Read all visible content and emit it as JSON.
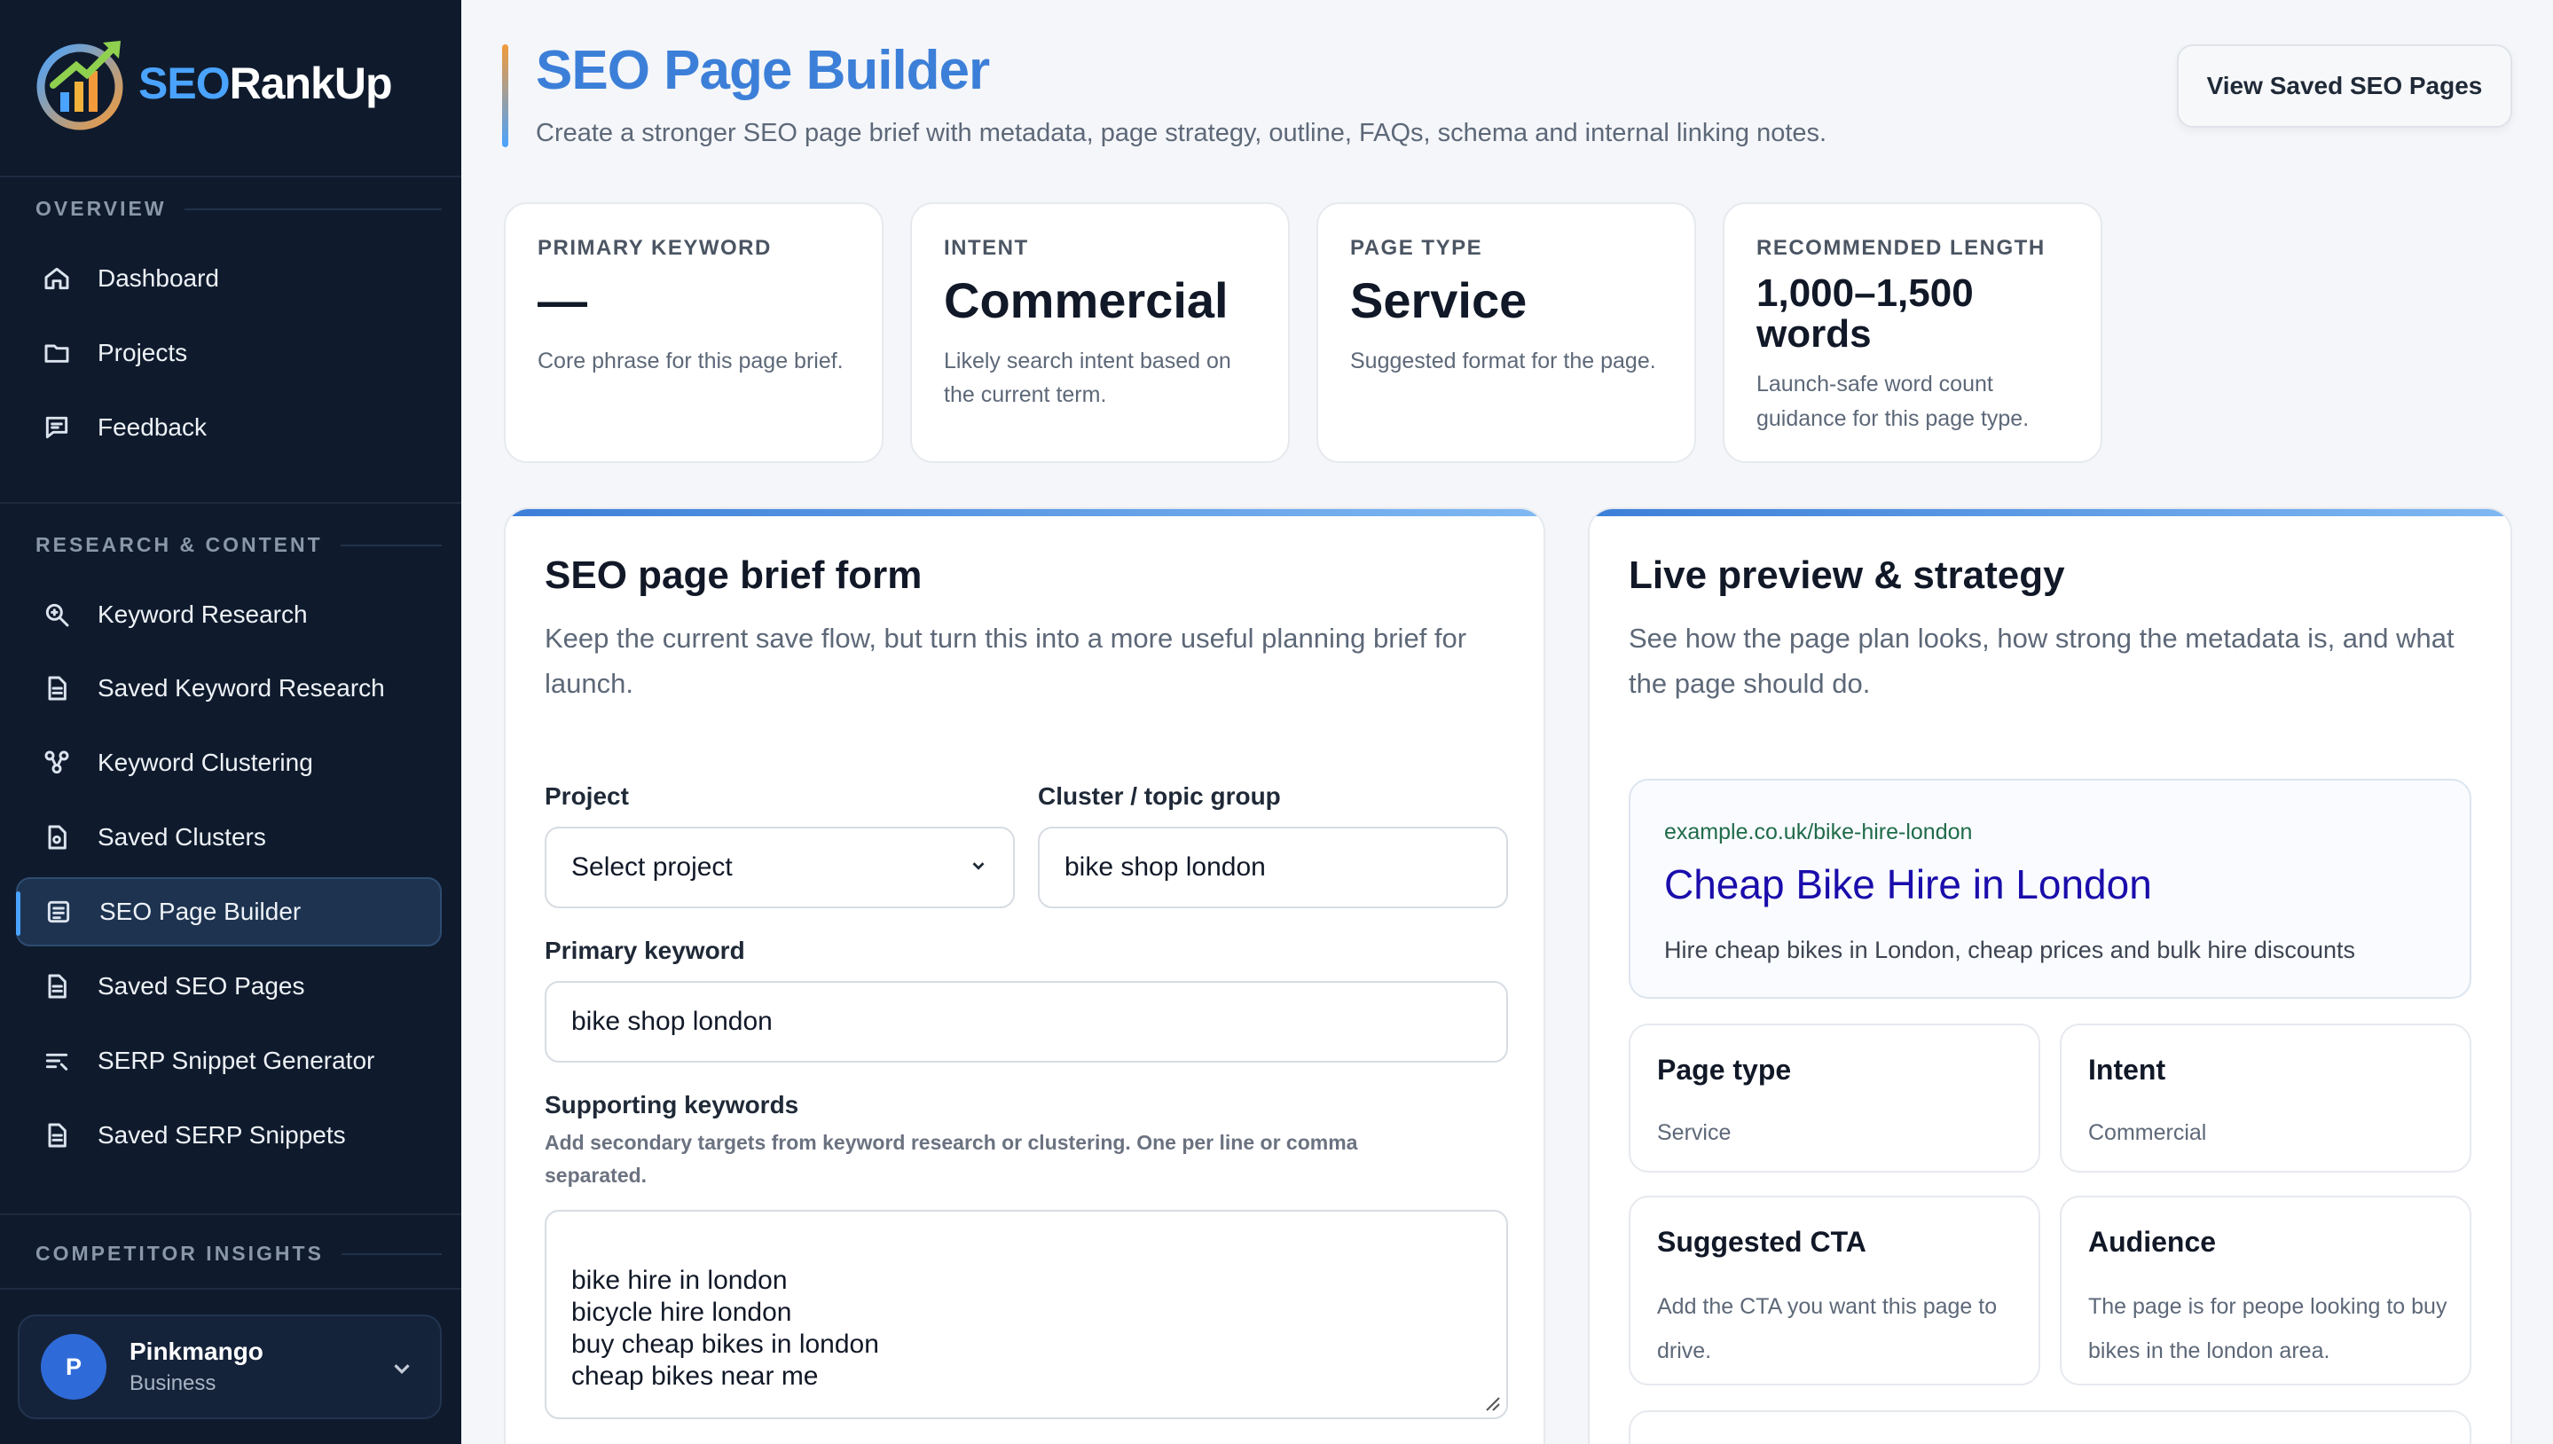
{
  "brand": {
    "seo": "SEO",
    "rank": "RankUp"
  },
  "sidebar": {
    "sections": {
      "overview": "OVERVIEW",
      "research": "RESEARCH & CONTENT",
      "competitor": "COMPETITOR INSIGHTS"
    },
    "overview_items": [
      {
        "label": "Dashboard",
        "icon": "home-icon"
      },
      {
        "label": "Projects",
        "icon": "folder-icon"
      },
      {
        "label": "Feedback",
        "icon": "message-icon"
      }
    ],
    "research_items": [
      {
        "label": "Keyword Research",
        "icon": "search-icon"
      },
      {
        "label": "Saved Keyword Research",
        "icon": "document-icon"
      },
      {
        "label": "Keyword Clustering",
        "icon": "cluster-icon"
      },
      {
        "label": "Saved Clusters",
        "icon": "saved-document-icon"
      },
      {
        "label": "SEO Page Builder",
        "icon": "page-builder-icon",
        "active": true
      },
      {
        "label": "Saved SEO Pages",
        "icon": "document-icon"
      },
      {
        "label": "SERP Snippet Generator",
        "icon": "snippet-icon"
      },
      {
        "label": "Saved SERP Snippets",
        "icon": "document-icon"
      }
    ],
    "user": {
      "initial": "P",
      "name": "Pinkmango",
      "plan": "Business"
    }
  },
  "header": {
    "title": "SEO Page Builder",
    "subtitle": "Create a stronger SEO page brief with metadata, page strategy, outline, FAQs, schema and internal linking notes.",
    "saved_button": "View Saved SEO Pages"
  },
  "stats": [
    {
      "key": "PRIMARY KEYWORD",
      "value": "—",
      "desc": "Core phrase for this page brief."
    },
    {
      "key": "INTENT",
      "value": "Commercial",
      "desc": "Likely search intent based on the current term."
    },
    {
      "key": "PAGE TYPE",
      "value": "Service",
      "desc": "Suggested format for the page."
    },
    {
      "key": "RECOMMENDED LENGTH",
      "value": "1,000–1,500 words",
      "desc": "Launch-safe word count guidance for this page type."
    }
  ],
  "form": {
    "title": "SEO page brief form",
    "subtitle": "Keep the current save flow, but turn this into a more useful planning brief for launch.",
    "project_label": "Project",
    "project_value": "Select project",
    "cluster_label": "Cluster / topic group",
    "cluster_value": "bike shop london",
    "primary_label": "Primary keyword",
    "primary_value": "bike shop london",
    "supporting_label": "Supporting keywords",
    "supporting_help": "Add secondary targets from keyword research or clustering. One per line or comma separated.",
    "supporting_value": "bike hire in london\nbicycle hire london\nbuy cheap bikes in london\ncheap bikes near me"
  },
  "preview": {
    "title": "Live preview & strategy",
    "subtitle": "See how the page plan looks, how strong the metadata is, and what the page should do.",
    "serp": {
      "url": "example.co.uk/bike-hire-london",
      "title": "Cheap Bike Hire in London",
      "description": "Hire cheap bikes in London, cheap prices and bulk hire discounts"
    },
    "cards": [
      {
        "title": "Page type",
        "desc": "Service"
      },
      {
        "title": "Intent",
        "desc": "Commercial"
      },
      {
        "title": "Suggested CTA",
        "desc": "Add the CTA you want this page to drive."
      },
      {
        "title": "Audience",
        "desc": "The page is for peope looking to buy bikes in the london area."
      }
    ]
  },
  "colors": {
    "sidebar_bg": "#0f1b2d",
    "accent": "#3c7fd8",
    "serp_title": "#1a0dab",
    "serp_url": "#1f6b4a"
  }
}
